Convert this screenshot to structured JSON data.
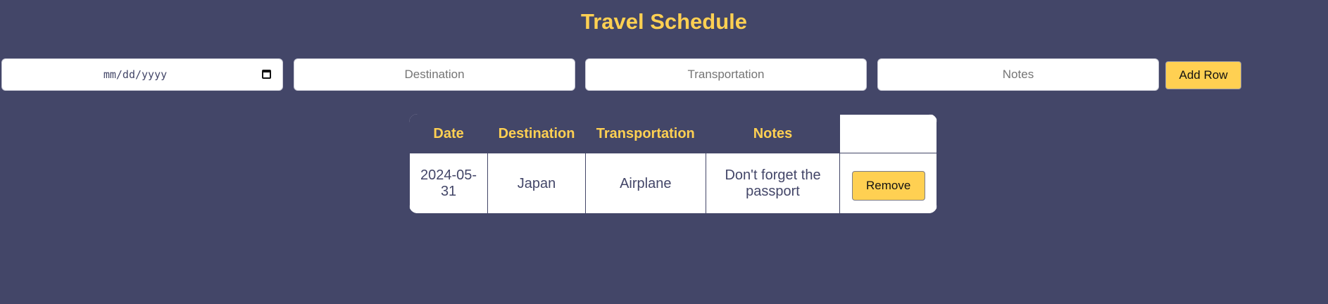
{
  "title": "Travel Schedule",
  "form": {
    "date_format": "mm/dd/yyyy",
    "destination_placeholder": "Destination",
    "transportation_placeholder": "Transportation",
    "notes_placeholder": "Notes",
    "add_label": "Add Row"
  },
  "table": {
    "headers": [
      "Date",
      "Destination",
      "Transportation",
      "Notes",
      ""
    ],
    "rows": [
      {
        "date": "2024-05-31",
        "destination": "Japan",
        "transportation": "Airplane",
        "notes": "Don't forget the passport",
        "action_label": "Remove"
      }
    ]
  },
  "icons": {
    "date_picker": "calendar-icon"
  },
  "colors": {
    "background": "#434668",
    "accent": "#FFD052",
    "text": "#434668"
  }
}
